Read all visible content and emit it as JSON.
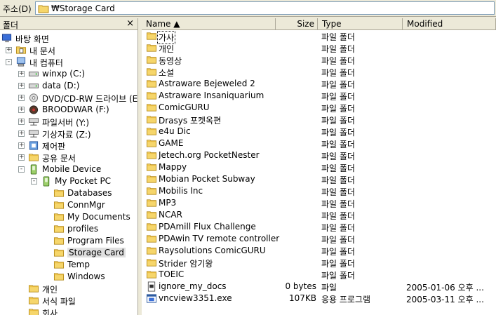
{
  "address": {
    "label": "주소(D)",
    "value": "₩Storage Card"
  },
  "left_pane": {
    "title": "폴더",
    "close": "×",
    "tree": [
      {
        "label": "바탕 화면",
        "icon": "desktop-icon",
        "level": 0,
        "expander": ""
      },
      {
        "label": "내 문서",
        "icon": "my-documents-icon",
        "level": 1,
        "expander": "+"
      },
      {
        "label": "내 컴퓨터",
        "icon": "my-computer-icon",
        "level": 1,
        "expander": "-"
      },
      {
        "label": "winxp (C:)",
        "icon": "hard-drive-icon",
        "level": 2,
        "expander": "+"
      },
      {
        "label": "data (D:)",
        "icon": "hard-drive-icon",
        "level": 2,
        "expander": "+"
      },
      {
        "label": "DVD/CD-RW 드라이브 (E:)",
        "icon": "cd-drive-icon",
        "level": 2,
        "expander": "+"
      },
      {
        "label": "BROODWAR (F:)",
        "icon": "cd-game-icon",
        "level": 2,
        "expander": "+"
      },
      {
        "label": "파일서버 (Y:)",
        "icon": "network-drive-icon",
        "level": 2,
        "expander": "+"
      },
      {
        "label": "기상자료 (Z:)",
        "icon": "network-drive-icon",
        "level": 2,
        "expander": "+"
      },
      {
        "label": "제어판",
        "icon": "control-panel-icon",
        "level": 2,
        "expander": "+"
      },
      {
        "label": "공유 문서",
        "icon": "folder-icon",
        "level": 2,
        "expander": "+"
      },
      {
        "label": "Mobile Device",
        "icon": "mobile-device-icon",
        "level": 2,
        "expander": "-"
      },
      {
        "label": "My Pocket PC",
        "icon": "pocket-pc-icon",
        "level": 3,
        "expander": "-"
      },
      {
        "label": "Databases",
        "icon": "folder-icon",
        "level": 4,
        "expander": ""
      },
      {
        "label": "ConnMgr",
        "icon": "folder-icon",
        "level": 4,
        "expander": ""
      },
      {
        "label": "My Documents",
        "icon": "folder-icon",
        "level": 4,
        "expander": ""
      },
      {
        "label": "profiles",
        "icon": "folder-icon",
        "level": 4,
        "expander": ""
      },
      {
        "label": "Program Files",
        "icon": "folder-icon",
        "level": 4,
        "expander": ""
      },
      {
        "label": "Storage Card",
        "icon": "folder-icon",
        "level": 4,
        "expander": "",
        "selected": true
      },
      {
        "label": "Temp",
        "icon": "folder-icon",
        "level": 4,
        "expander": ""
      },
      {
        "label": "Windows",
        "icon": "folder-icon",
        "level": 4,
        "expander": ""
      },
      {
        "label": "개인",
        "icon": "folder-icon",
        "level": 2,
        "expander": ""
      },
      {
        "label": "서식 파일",
        "icon": "folder-icon",
        "level": 2,
        "expander": ""
      },
      {
        "label": "회사",
        "icon": "folder-icon",
        "level": 2,
        "expander": ""
      }
    ]
  },
  "columns": [
    {
      "key": "name",
      "label": "Name ▲"
    },
    {
      "key": "size",
      "label": "Size"
    },
    {
      "key": "type",
      "label": "Type"
    },
    {
      "key": "modified",
      "label": "Modified"
    }
  ],
  "rows": [
    {
      "name": "가사",
      "size": "",
      "type": "파일 폴더",
      "modified": "",
      "icon": "folder-icon",
      "focused": true
    },
    {
      "name": "개인",
      "size": "",
      "type": "파일 폴더",
      "modified": "",
      "icon": "folder-icon"
    },
    {
      "name": "동영상",
      "size": "",
      "type": "파일 폴더",
      "modified": "",
      "icon": "folder-icon"
    },
    {
      "name": "소설",
      "size": "",
      "type": "파일 폴더",
      "modified": "",
      "icon": "folder-icon"
    },
    {
      "name": "Astraware Bejeweled 2",
      "size": "",
      "type": "파일 폴더",
      "modified": "",
      "icon": "folder-icon"
    },
    {
      "name": "Astraware Insaniquarium",
      "size": "",
      "type": "파일 폴더",
      "modified": "",
      "icon": "folder-icon"
    },
    {
      "name": "ComicGURU",
      "size": "",
      "type": "파일 폴더",
      "modified": "",
      "icon": "folder-icon"
    },
    {
      "name": "Drasys 포켓옥편",
      "size": "",
      "type": "파일 폴더",
      "modified": "",
      "icon": "folder-icon"
    },
    {
      "name": "e4u Dic",
      "size": "",
      "type": "파일 폴더",
      "modified": "",
      "icon": "folder-icon"
    },
    {
      "name": "GAME",
      "size": "",
      "type": "파일 폴더",
      "modified": "",
      "icon": "folder-icon"
    },
    {
      "name": "Jetech.org PocketNester",
      "size": "",
      "type": "파일 폴더",
      "modified": "",
      "icon": "folder-icon"
    },
    {
      "name": "Mappy",
      "size": "",
      "type": "파일 폴더",
      "modified": "",
      "icon": "folder-icon"
    },
    {
      "name": "Mobian Pocket Subway",
      "size": "",
      "type": "파일 폴더",
      "modified": "",
      "icon": "folder-icon"
    },
    {
      "name": "Mobilis Inc",
      "size": "",
      "type": "파일 폴더",
      "modified": "",
      "icon": "folder-icon"
    },
    {
      "name": "MP3",
      "size": "",
      "type": "파일 폴더",
      "modified": "",
      "icon": "folder-icon"
    },
    {
      "name": "NCAR",
      "size": "",
      "type": "파일 폴더",
      "modified": "",
      "icon": "folder-icon"
    },
    {
      "name": "PDAmill Flux Challenge",
      "size": "",
      "type": "파일 폴더",
      "modified": "",
      "icon": "folder-icon"
    },
    {
      "name": "PDAwin TV remote controller",
      "size": "",
      "type": "파일 폴더",
      "modified": "",
      "icon": "folder-icon"
    },
    {
      "name": "Raysolutions ComicGURU",
      "size": "",
      "type": "파일 폴더",
      "modified": "",
      "icon": "folder-icon"
    },
    {
      "name": "Strider 암기왕",
      "size": "",
      "type": "파일 폴더",
      "modified": "",
      "icon": "folder-icon"
    },
    {
      "name": "TOEIC",
      "size": "",
      "type": "파일 폴더",
      "modified": "",
      "icon": "folder-icon"
    },
    {
      "name": "ignore_my_docs",
      "size": "0 bytes",
      "type": "파일",
      "modified": "2005-01-06  오후 ...",
      "icon": "file-icon"
    },
    {
      "name": "vncview3351.exe",
      "size": "107KB",
      "type": "응용 프로그램",
      "modified": "2005-03-11  오후 ...",
      "icon": "exe-icon"
    }
  ]
}
